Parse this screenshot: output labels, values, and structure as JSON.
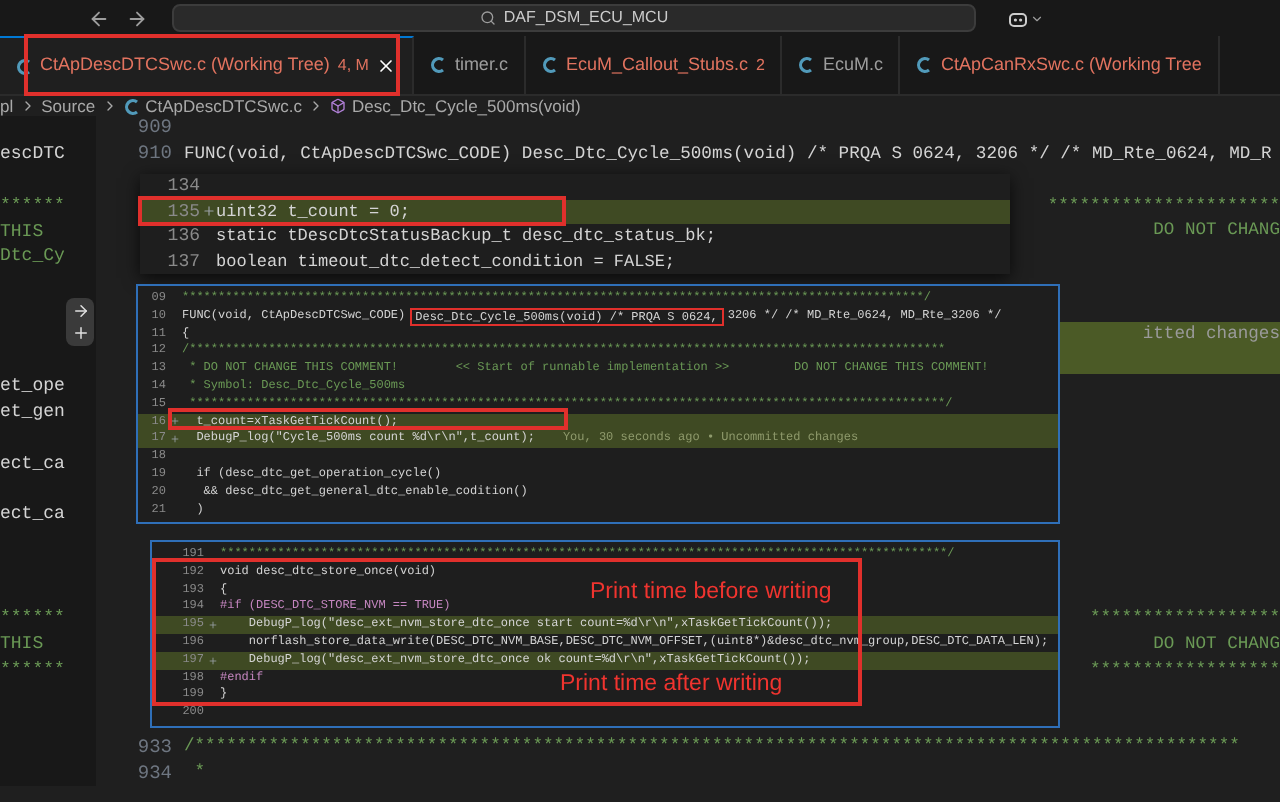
{
  "titlebar": {
    "search": "DAF_DSM_ECU_MCU"
  },
  "tabs": [
    {
      "label": "CtApDescDTCSwc.c (Working Tree)",
      "badge": "4, M",
      "modified": true,
      "selected": true
    },
    {
      "label": "timer.c",
      "modified": false,
      "selected": false
    },
    {
      "label": "EcuM_Callout_Stubs.c",
      "badge": "2",
      "modified": true,
      "selected": false
    },
    {
      "label": "EcuM.c",
      "modified": false,
      "selected": false
    },
    {
      "label": "CtApCanRxSwc.c (Working Tree",
      "modified": true,
      "selected": false
    }
  ],
  "breadcrumb": [
    {
      "label": "pl",
      "kind": "folder"
    },
    {
      "label": "Source",
      "kind": "folder"
    },
    {
      "label": "CtApDescDTCSwc.c",
      "kind": "file"
    },
    {
      "label": "Desc_Dtc_Cycle_500ms(void)",
      "kind": "symbol"
    }
  ],
  "editor": {
    "rows": [
      {
        "number": "909",
        "added": false
      },
      {
        "number": "910",
        "code": "FUNC(void, CtApDescDTCSwc_CODE) Desc_Dtc_Cycle_500ms(void) /* PRQA S 0624, 3206 */ /* MD_Rte_0624, MD_R",
        "kind": "code",
        "side": {
          "text": "escDTC",
          "kind": "code"
        },
        "added": false
      },
      {
        "added": false
      },
      {
        "side": {
          "text": "******",
          "kind": "comment"
        },
        "right": {
          "text": "**********************",
          "kind": "comment"
        },
        "added": false
      },
      {
        "side": {
          "text": "THIS",
          "kind": "comment"
        },
        "right": {
          "text": "DO NOT CHANG",
          "kind": "comment"
        },
        "added": false
      },
      {
        "side": {
          "text": "Dtc_Cy",
          "kind": "comment"
        },
        "added": false
      },
      {
        "added": false
      },
      {
        "added": false
      },
      {
        "right": {
          "text": "itted changes",
          "kind": "blame"
        },
        "added": true
      },
      {
        "added": true
      },
      {
        "side": {
          "text": "et_ope",
          "kind": "code"
        },
        "added": false
      },
      {
        "side": {
          "text": "et_gen",
          "kind": "code"
        },
        "added": false
      },
      {
        "added": false
      },
      {
        "side": {
          "text": "ect_ca",
          "kind": "code"
        },
        "added": false
      },
      {
        "added": false
      },
      {
        "side": {
          "text": "ect_ca",
          "kind": "code"
        },
        "added": false
      },
      {
        "added": false
      },
      {
        "added": false
      },
      {
        "added": false
      },
      {
        "side": {
          "text": "******",
          "kind": "comment"
        },
        "right": {
          "text": "******************",
          "kind": "comment"
        },
        "added": false
      },
      {
        "side": {
          "text": "THIS",
          "kind": "comment"
        },
        "right": {
          "text": "DO NOT CHANG",
          "kind": "comment"
        },
        "added": false
      },
      {
        "side": {
          "text": "******",
          "kind": "comment"
        },
        "right": {
          "text": "******************",
          "kind": "comment"
        },
        "added": false
      },
      {
        "added": false
      },
      {
        "added": false
      },
      {
        "number": "933",
        "code": "/***************************************************************************************************",
        "kind": "comment",
        "added": false
      },
      {
        "number": "934",
        "code": " *",
        "kind": "comment",
        "added": false
      }
    ]
  },
  "peeks": [
    {
      "lines": [
        {
          "number": "134",
          "added": false
        },
        {
          "number": "135",
          "text": "uint32 t_count = 0;",
          "kind": "code",
          "added": true
        },
        {
          "number": "136",
          "text": "static tDescDtcStatusBackup_t desc_dtc_status_bk;",
          "kind": "code",
          "added": false
        },
        {
          "number": "137",
          "text": "boolean timeout_dtc_detect_condition = FALSE;",
          "kind": "code",
          "added": false
        }
      ]
    },
    {
      "lines": [
        {
          "number": "09",
          "text": "*******************************************************************************************************/",
          "kind": "comment",
          "added": false
        },
        {
          "number": "10",
          "segments": [
            {
              "text": "FUNC(void, CtApDescDTCSwc_CODE)",
              "boxed": false
            },
            {
              "text": "Desc_Dtc_Cycle_500ms(void) /* PRQA S 0624,",
              "boxed": true
            },
            {
              "text": "3206 */ /* MD_Rte_0624, MD_Rte_3206 */",
              "boxed": false
            }
          ],
          "kind": "code",
          "added": false
        },
        {
          "number": "11",
          "text": "{",
          "kind": "code",
          "added": false
        },
        {
          "number": "12",
          "text": "/*********************************************************************************************************",
          "kind": "comment",
          "added": false
        },
        {
          "number": "13",
          "text": " * DO NOT CHANGE THIS COMMENT!        << Start of runnable implementation >>         DO NOT CHANGE THIS COMMENT!",
          "kind": "comment",
          "added": false
        },
        {
          "number": "14",
          "text": " * Symbol: Desc_Dtc_Cycle_500ms",
          "kind": "comment",
          "added": false
        },
        {
          "number": "15",
          "text": " *********************************************************************************************************/",
          "kind": "comment",
          "added": false
        },
        {
          "number": "16",
          "text": "  t_count=xTaskGetTickCount();",
          "kind": "code",
          "added": true
        },
        {
          "number": "17",
          "text": "  DebugP_log(\"Cycle_500ms count %d\\r\\n\",t_count);",
          "kind": "code",
          "added": true,
          "blame": "You, 30 seconds ago • Uncommitted changes"
        },
        {
          "number": "18",
          "added": false
        },
        {
          "number": "19",
          "text": "  if (desc_dtc_get_operation_cycle()",
          "kind": "code",
          "added": false
        },
        {
          "number": "20",
          "text": "   && desc_dtc_get_general_dtc_enable_codition()",
          "kind": "code",
          "added": false
        },
        {
          "number": "21",
          "text": "  )",
          "kind": "code",
          "added": false
        }
      ]
    },
    {
      "lines": [
        {
          "number": "191",
          "text": "*****************************************************************************************************/",
          "kind": "comment",
          "added": false
        },
        {
          "number": "192",
          "text": "void desc_dtc_store_once(void)",
          "kind": "code",
          "added": false
        },
        {
          "number": "193",
          "text": "{",
          "kind": "code",
          "added": false
        },
        {
          "number": "194",
          "text": "#if (DESC_DTC_STORE_NVM == TRUE)",
          "kind": "preproc",
          "added": false
        },
        {
          "number": "195",
          "text": "    DebugP_log(\"desc_ext_nvm_store_dtc_once start count=%d\\r\\n\",xTaskGetTickCount());",
          "kind": "code",
          "added": true
        },
        {
          "number": "196",
          "text": "    norflash_store_data_write(DESC_DTC_NVM_BASE,DESC_DTC_NVM_OFFSET,(uint8*)&desc_dtc_nvm_group,DESC_DTC_DATA_LEN);",
          "kind": "code",
          "added": false
        },
        {
          "number": "197",
          "text": "    DebugP_log(\"desc_ext_nvm_store_dtc_once ok count=%d\\r\\n\",xTaskGetTickCount());",
          "kind": "code",
          "added": true
        },
        {
          "number": "198",
          "text": "#endif",
          "kind": "preproc",
          "added": false
        },
        {
          "number": "199",
          "text": "}",
          "kind": "code",
          "added": false
        },
        {
          "number": "200",
          "added": false
        }
      ]
    }
  ],
  "annotations": [
    {
      "text": "Print time before writing"
    },
    {
      "text": "Print time after writing"
    }
  ]
}
